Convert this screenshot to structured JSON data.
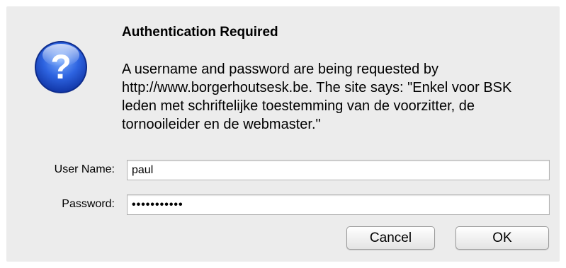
{
  "dialog": {
    "title": "Authentication Required",
    "message": "A username and password are being requested by http://www.borgerhoutsesk.be. The site says: \"Enkel voor BSK leden met schriftelijke toestemming van de voorzitter, de tornooileider en de webmaster.\"",
    "icon": "question-icon"
  },
  "form": {
    "username_label": "User Name:",
    "username_value": "paul",
    "password_label": "Password:",
    "password_value": "•••••••••••"
  },
  "buttons": {
    "cancel_label": "Cancel",
    "ok_label": "OK"
  },
  "colors": {
    "dialog_bg": "#ececec",
    "icon_blue": "#2a5fd6"
  }
}
